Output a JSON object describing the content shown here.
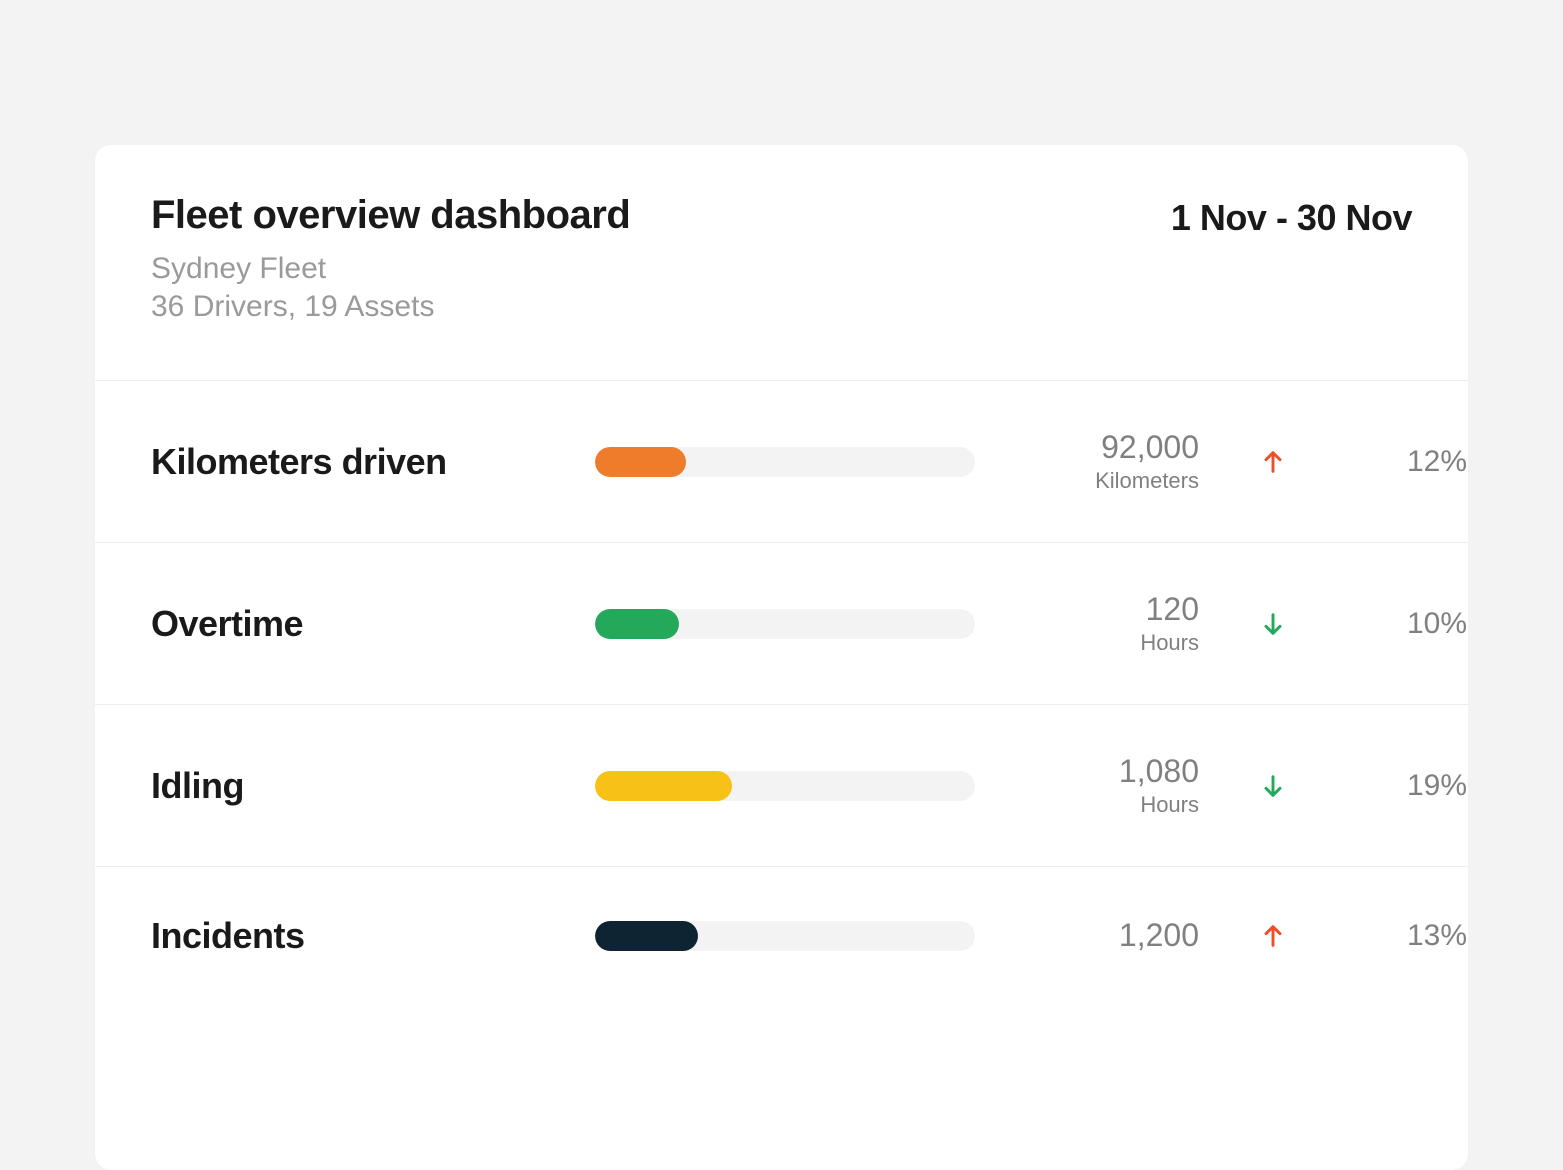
{
  "header": {
    "title": "Fleet overview dashboard",
    "fleet_name": "Sydney Fleet",
    "fleet_stats": "36 Drivers, 19 Assets",
    "date_range": "1 Nov - 30 Nov"
  },
  "colors": {
    "orange": "#ef7c2b",
    "green": "#24a95b",
    "yellow": "#f7c117",
    "dark": "#0e2433",
    "arrow_up": "#ee4f28",
    "arrow_down": "#24a95b"
  },
  "metrics": [
    {
      "label": "Kilometers driven",
      "value": "92,000",
      "unit": "Kilometers",
      "fill_pct": 24,
      "fill_color": "orange",
      "trend": "up",
      "change": "12%"
    },
    {
      "label": "Overtime",
      "value": "120",
      "unit": "Hours",
      "fill_pct": 22,
      "fill_color": "green",
      "trend": "down",
      "change": "10%"
    },
    {
      "label": "Idling",
      "value": "1,080",
      "unit": "Hours",
      "fill_pct": 36,
      "fill_color": "yellow",
      "trend": "down",
      "change": "19%"
    },
    {
      "label": "Incidents",
      "value": "1,200",
      "unit": "",
      "fill_pct": 27,
      "fill_color": "dark",
      "trend": "up",
      "change": "13%"
    }
  ]
}
